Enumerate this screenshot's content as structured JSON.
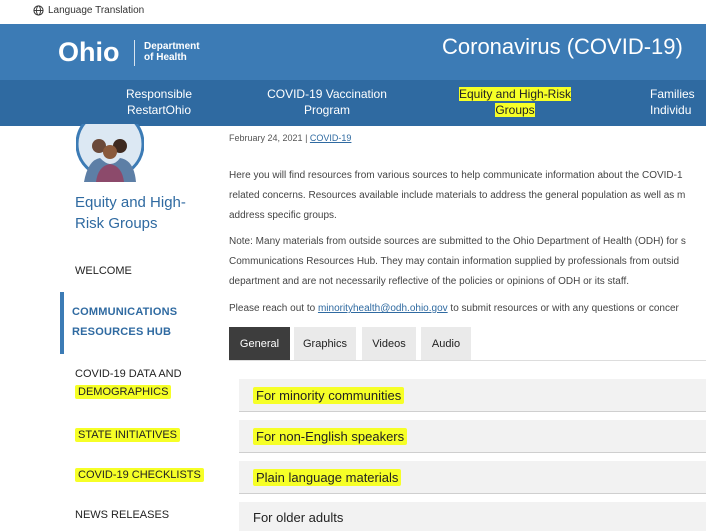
{
  "top_bar": {
    "language_label": "Language Translation",
    "globe_icon": "globe-icon"
  },
  "header": {
    "logo_word": "Ohio",
    "logo_dept_line1": "Department",
    "logo_dept_line2": "of Health",
    "title": "Coronavirus (COVID-19)",
    "background": "#3c7bb5"
  },
  "nav": {
    "items": [
      {
        "line1": "Responsible",
        "line2": "RestartOhio"
      },
      {
        "line1": "COVID-19 Vaccination",
        "line2": "Program"
      },
      {
        "line1": "Equity and High-Risk",
        "line2": "Groups"
      },
      {
        "line1": "Families",
        "line2": "Individu"
      }
    ],
    "highlight_color": "#f6ff27"
  },
  "sidebar": {
    "title": "Equity and High-Risk Groups",
    "items": [
      {
        "label": "WELCOME"
      },
      {
        "line1": "COMMUNICATIONS",
        "line2": "RESOURCES HUB"
      },
      {
        "line1": "COVID-19 DATA AND",
        "line2": "DEMOGRAPHICS"
      },
      {
        "label": "STATE INITIATIVES"
      },
      {
        "label": "COVID-19 CHECKLISTS"
      },
      {
        "label": "NEWS RELEASES"
      }
    ]
  },
  "content": {
    "date": "February 24, 2021",
    "separator": "|",
    "category": "COVID-19",
    "para1_lines": [
      "Here you will find resources from various sources to help communicate information about the COVID-1",
      "related concerns. Resources available include materials to address the general population as well as m",
      "address specific groups."
    ],
    "para2_lines": [
      "Note: Many materials from outside sources are submitted to the Ohio Department of Health (ODH) for s",
      "Communications Resources Hub. They may contain information supplied by professionals from outsid",
      "department and are not necessarily reflective of the policies or opinions of ODH or its staff."
    ],
    "para3_before": "Please reach out to ",
    "para3_email": "minorityhealth@odh.ohio.gov",
    "para3_after": " to submit resources or with any questions or concer",
    "tabs": [
      "General",
      "Graphics",
      "Videos",
      "Audio"
    ],
    "active_tab": "General",
    "accordion": [
      "For minority communities",
      "For non-English speakers",
      "Plain language materials",
      "For older adults"
    ]
  }
}
